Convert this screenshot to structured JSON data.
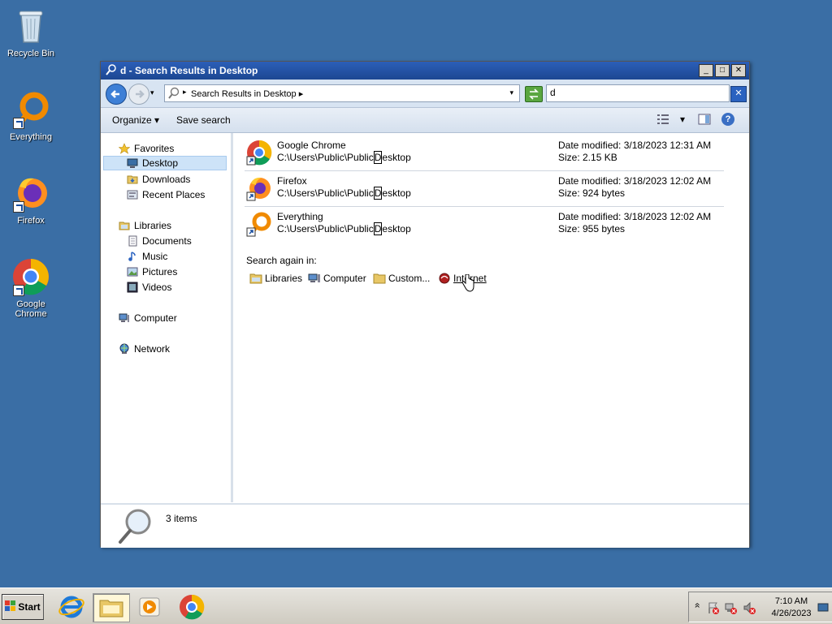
{
  "desktop": {
    "icons": [
      {
        "label": "Recycle Bin"
      },
      {
        "label": "Everything"
      },
      {
        "label": "Firefox"
      },
      {
        "label": "Google Chrome"
      }
    ]
  },
  "window": {
    "title": "d - Search Results in Desktop",
    "controls": {
      "minimize": "_",
      "maximize": "□",
      "close": "✕"
    },
    "address": {
      "text": "Search Results in Desktop",
      "chevron": "▸",
      "dropdown": "▾"
    },
    "search": {
      "value": "d",
      "clear": "✕"
    }
  },
  "toolbar": {
    "organize": "Organize",
    "organize_arrow": "▾",
    "save_search": "Save search",
    "views_arrow": "▾",
    "help": "?"
  },
  "nav": {
    "favorites": "Favorites",
    "desktop": "Desktop",
    "downloads": "Downloads",
    "recent_places": "Recent Places",
    "libraries": "Libraries",
    "documents": "Documents",
    "music": "Music",
    "pictures": "Pictures",
    "videos": "Videos",
    "computer": "Computer",
    "network": "Network"
  },
  "results": [
    {
      "name": "Google Chrome",
      "path_pre": "C:\\Users\\Public\\Public",
      "path_hl": "D",
      "path_post": "esktop",
      "date": "Date modified: 3/18/2023 12:31 AM",
      "size": "Size: 2.15 KB"
    },
    {
      "name": "Firefox",
      "path_pre": "C:\\Users\\Public\\Public",
      "path_hl": "D",
      "path_post": "esktop",
      "date": "Date modified: 3/18/2023 12:02 AM",
      "size": "Size: 924 bytes"
    },
    {
      "name": "Everything",
      "path_pre": "C:\\Users\\Public\\Public",
      "path_hl": "D",
      "path_post": "esktop",
      "date": "Date modified: 3/18/2023 12:02 AM",
      "size": "Size: 955 bytes"
    }
  ],
  "search_again": {
    "label": "Search again in:",
    "libraries": "Libraries",
    "computer": "Computer",
    "custom": "Custom...",
    "internet": "Internet"
  },
  "details": {
    "count": "3 items"
  },
  "taskbar": {
    "start": "Start",
    "tray_expand": "»",
    "clock_time": "7:10 AM",
    "clock_date": "4/26/2023"
  }
}
